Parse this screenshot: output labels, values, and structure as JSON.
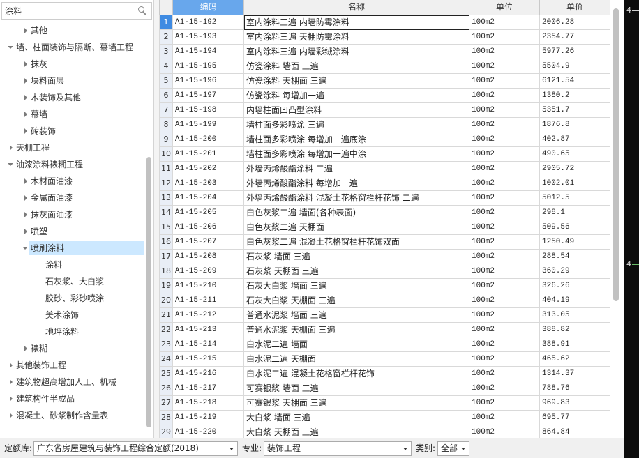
{
  "search": {
    "value": "涂料"
  },
  "icons": {
    "search": "search-icon",
    "collapsed": "chevron-right-icon",
    "expanded": "chevron-down-icon",
    "dropdown": "chevron-down-icon"
  },
  "tree": [
    {
      "label": "其他",
      "depth": 1,
      "icon": "chevron-right-icon"
    },
    {
      "label": "墙、柱面装饰与隔断、幕墙工程",
      "depth": 0,
      "icon": "chevron-down-icon"
    },
    {
      "label": "抹灰",
      "depth": 1,
      "icon": "chevron-right-icon"
    },
    {
      "label": "块料面层",
      "depth": 1,
      "icon": "chevron-right-icon"
    },
    {
      "label": "木装饰及其他",
      "depth": 1,
      "icon": "chevron-right-icon"
    },
    {
      "label": "幕墙",
      "depth": 1,
      "icon": "chevron-right-icon"
    },
    {
      "label": "砖装饰",
      "depth": 1,
      "icon": "chevron-right-icon"
    },
    {
      "label": "天棚工程",
      "depth": 0,
      "icon": "chevron-right-icon"
    },
    {
      "label": "油漆涂料裱糊工程",
      "depth": 0,
      "icon": "chevron-down-icon"
    },
    {
      "label": "木材面油漆",
      "depth": 1,
      "icon": "chevron-right-icon"
    },
    {
      "label": "金属面油漆",
      "depth": 1,
      "icon": "chevron-right-icon"
    },
    {
      "label": "抹灰面油漆",
      "depth": 1,
      "icon": "chevron-right-icon"
    },
    {
      "label": "喷塑",
      "depth": 1,
      "icon": "chevron-right-icon"
    },
    {
      "label": "喷刷涂料",
      "depth": 1,
      "icon": "chevron-down-icon",
      "selected": true
    },
    {
      "label": "涂料",
      "depth": 2
    },
    {
      "label": "石灰浆、大白浆",
      "depth": 2
    },
    {
      "label": "胶砂、彩砂喷涂",
      "depth": 2
    },
    {
      "label": "美术涂饰",
      "depth": 2
    },
    {
      "label": "地坪涂料",
      "depth": 2
    },
    {
      "label": "裱糊",
      "depth": 1,
      "icon": "chevron-right-icon"
    },
    {
      "label": "其他装饰工程",
      "depth": 0,
      "icon": "chevron-right-icon"
    },
    {
      "label": "建筑物超高增加人工、机械",
      "depth": 0,
      "icon": "chevron-right-icon"
    },
    {
      "label": "建筑构件半成品",
      "depth": 0,
      "icon": "chevron-right-icon"
    },
    {
      "label": "混凝土、砂浆制作含量表",
      "depth": 0,
      "icon": "chevron-right-icon"
    }
  ],
  "table": {
    "columns": [
      {
        "label": ""
      },
      {
        "label": "编码",
        "active": true
      },
      {
        "label": "名称"
      },
      {
        "label": "单位"
      },
      {
        "label": "单价"
      }
    ],
    "selected_row_index": 0,
    "focused_cell": {
      "row_index": 0,
      "column_index": 2
    },
    "rows": [
      [
        "1",
        "A1-15-192",
        "室内涂料三遍 内墙防霉涂料",
        "100m2",
        "2006.28"
      ],
      [
        "2",
        "A1-15-193",
        "室内涂料三遍 天棚防霉涂料",
        "100m2",
        "2354.77"
      ],
      [
        "3",
        "A1-15-194",
        "室内涂料三遍 内墙彩绒涂料",
        "100m2",
        "5977.26"
      ],
      [
        "4",
        "A1-15-195",
        "仿瓷涂料 墙面 三遍",
        "100m2",
        "5504.9"
      ],
      [
        "5",
        "A1-15-196",
        "仿瓷涂料 天棚面 三遍",
        "100m2",
        "6121.54"
      ],
      [
        "6",
        "A1-15-197",
        "仿瓷涂料 每增加一遍",
        "100m2",
        "1380.2"
      ],
      [
        "7",
        "A1-15-198",
        "内墙柱面凹凸型涂料",
        "100m2",
        "5351.7"
      ],
      [
        "8",
        "A1-15-199",
        "墙柱面多彩喷涂 三遍",
        "100m2",
        "1876.8"
      ],
      [
        "9",
        "A1-15-200",
        "墙柱面多彩喷涂 每增加一遍底涂",
        "100m2",
        "402.87"
      ],
      [
        "10",
        "A1-15-201",
        "墙柱面多彩喷涂 每增加一遍中涂",
        "100m2",
        "490.65"
      ],
      [
        "11",
        "A1-15-202",
        "外墙丙烯酸酯涂料 二遍",
        "100m2",
        "2905.72"
      ],
      [
        "12",
        "A1-15-203",
        "外墙丙烯酸酯涂料 每增加一遍",
        "100m2",
        "1002.01"
      ],
      [
        "13",
        "A1-15-204",
        "外墙丙烯酸酯涂料 混凝土花格窗栏杆花饰 二遍",
        "100m2",
        "5012.5"
      ],
      [
        "14",
        "A1-15-205",
        "白色灰浆二遍 墙面(各种表面)",
        "100m2",
        "298.1"
      ],
      [
        "15",
        "A1-15-206",
        "白色灰浆二遍 天棚面",
        "100m2",
        "509.56"
      ],
      [
        "16",
        "A1-15-207",
        "白色灰浆二遍 混凝土花格窗栏杆花饰双面",
        "100m2",
        "1250.49"
      ],
      [
        "17",
        "A1-15-208",
        "石灰浆 墙面 三遍",
        "100m2",
        "288.54"
      ],
      [
        "18",
        "A1-15-209",
        "石灰浆 天棚面 三遍",
        "100m2",
        "360.29"
      ],
      [
        "19",
        "A1-15-210",
        "石灰大白浆 墙面 三遍",
        "100m2",
        "326.26"
      ],
      [
        "20",
        "A1-15-211",
        "石灰大白浆 天棚面 三遍",
        "100m2",
        "404.19"
      ],
      [
        "21",
        "A1-15-212",
        "普通水泥浆 墙面 三遍",
        "100m2",
        "313.05"
      ],
      [
        "22",
        "A1-15-213",
        "普通水泥浆 天棚面 三遍",
        "100m2",
        "388.82"
      ],
      [
        "23",
        "A1-15-214",
        "白水泥二遍 墙面",
        "100m2",
        "388.91"
      ],
      [
        "24",
        "A1-15-215",
        "白水泥二遍 天棚面",
        "100m2",
        "465.62"
      ],
      [
        "25",
        "A1-15-216",
        "白水泥二遍 混凝土花格窗栏杆花饰",
        "100m2",
        "1314.37"
      ],
      [
        "26",
        "A1-15-217",
        "可赛银浆 墙面 三遍",
        "100m2",
        "788.76"
      ],
      [
        "27",
        "A1-15-218",
        "可赛银浆 天棚面 三遍",
        "100m2",
        "969.83"
      ],
      [
        "28",
        "A1-15-219",
        "大白浆 墙面 三遍",
        "100m2",
        "695.77"
      ],
      [
        "29",
        "A1-15-220",
        "大白浆 天棚面 三遍",
        "100m2",
        "864.84"
      ]
    ]
  },
  "footer": {
    "library_label": "定额库:",
    "library_value": "广东省房屋建筑与装饰工程综合定额(2018)",
    "specialty_label": "专业:",
    "specialty_value": "装饰工程",
    "category_label": "类别:",
    "category_value": "全部"
  },
  "background_window": {
    "glyph_top": "4",
    "glyph_bottom": "4"
  },
  "colors": {
    "tree_selection": "#cce8ff",
    "header_active": "#68a7ec",
    "row_number_active": "#3f8be2",
    "grid_line": "#d9d9d9",
    "header_bg": "#f0f0f0",
    "row_number_bg": "#e9eef6",
    "toolbar_bg": "#f0f0f0",
    "scroll_thumb": "#c1c1c1",
    "background_window": "#0c0c0c",
    "background_accent_line": "#6abf69"
  }
}
